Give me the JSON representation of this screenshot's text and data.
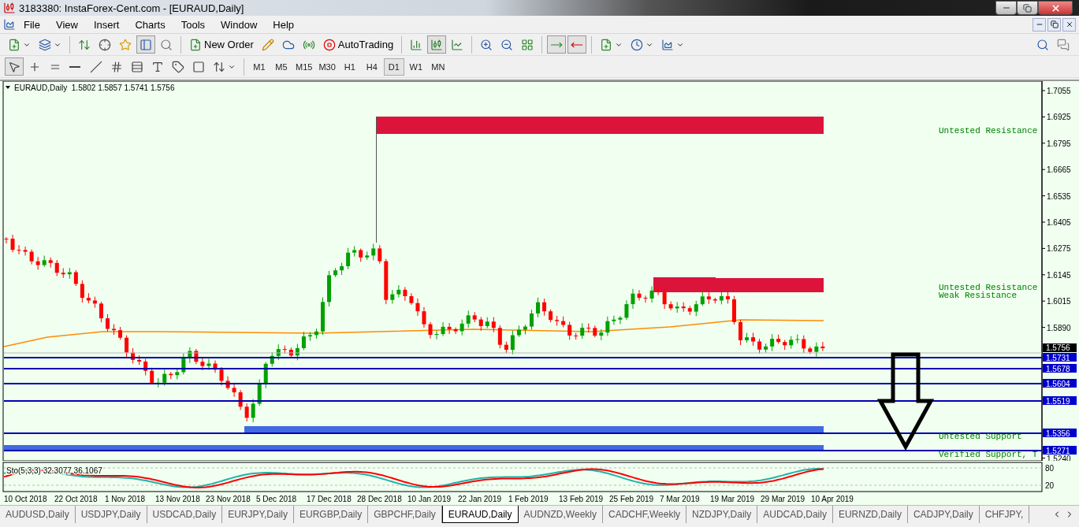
{
  "window": {
    "title": "3183380: InstaForex-Cent.com - [EURAUD,Daily]"
  },
  "menu": [
    "File",
    "View",
    "Insert",
    "Charts",
    "Tools",
    "Window",
    "Help"
  ],
  "toolbar": {
    "new_order": "New Order",
    "auto_trading": "AutoTrading",
    "auto_scroll": true,
    "chart_shift": true,
    "chart_types": [
      {
        "kind": "bars",
        "selected": false
      },
      {
        "kind": "candles",
        "selected": true
      },
      {
        "kind": "line",
        "selected": false
      }
    ]
  },
  "draw_tools": [
    {
      "kind": "cursor",
      "selected": true
    },
    {
      "kind": "crosshair",
      "selected": false
    },
    {
      "kind": "vline",
      "selected": false
    },
    {
      "kind": "hline",
      "selected": false
    },
    {
      "kind": "trend",
      "selected": false
    },
    {
      "kind": "channel",
      "selected": false
    },
    {
      "kind": "fibo",
      "selected": false
    },
    {
      "kind": "text",
      "selected": false
    },
    {
      "kind": "label",
      "selected": false
    },
    {
      "kind": "rectangle",
      "selected": false
    },
    {
      "kind": "arrows",
      "selected": false
    }
  ],
  "timeframes": [
    {
      "label": "M1",
      "selected": false
    },
    {
      "label": "M5",
      "selected": false
    },
    {
      "label": "M15",
      "selected": false
    },
    {
      "label": "M30",
      "selected": false
    },
    {
      "label": "H1",
      "selected": false
    },
    {
      "label": "H4",
      "selected": false
    },
    {
      "label": "D1",
      "selected": true
    },
    {
      "label": "W1",
      "selected": false
    },
    {
      "label": "MN",
      "selected": false
    }
  ],
  "chart": {
    "header": "EURAUD,Daily  1.5802 1.5857 1.5741 1.5756",
    "price_ticks": [
      "1.7055",
      "1.6925",
      "1.6795",
      "1.6665",
      "1.6535",
      "1.6405",
      "1.6275",
      "1.6145",
      "1.6015",
      "1.5890",
      "1.5240"
    ],
    "current_price": "1.5756",
    "levels": [
      {
        "price": "1.5731"
      },
      {
        "price": "1.5678"
      },
      {
        "price": "1.5604"
      },
      {
        "price": "1.5519"
      },
      {
        "price": "1.5356"
      },
      {
        "price": "1.5271"
      }
    ],
    "zone_labels": [
      "Untested Resistance",
      "Untested Resistance",
      "Weak Resistance",
      "Untested Support",
      "Verified Support, T"
    ],
    "indicator": {
      "label": "Sto(5,3,3) 32.3077 36.1067",
      "ticks": [
        "80",
        "20"
      ]
    },
    "dates": [
      "10 Oct 2018",
      "22 Oct 2018",
      "1 Nov 2018",
      "13 Nov 2018",
      "23 Nov 2018",
      "5 Dec 2018",
      "17 Dec 2018",
      "28 Dec 2018",
      "10 Jan 2019",
      "22 Jan 2019",
      "1 Feb 2019",
      "13 Feb 2019",
      "25 Feb 2019",
      "7 Mar 2019",
      "19 Mar 2019",
      "29 Mar 2019",
      "10 Apr 2019"
    ]
  },
  "tabs": [
    {
      "label": "AUDUSD,Daily",
      "selected": false
    },
    {
      "label": "USDJPY,Daily",
      "selected": false
    },
    {
      "label": "USDCAD,Daily",
      "selected": false
    },
    {
      "label": "EURJPY,Daily",
      "selected": false
    },
    {
      "label": "EURGBP,Daily",
      "selected": false
    },
    {
      "label": "GBPCHF,Daily",
      "selected": false
    },
    {
      "label": "EURAUD,Daily",
      "selected": true
    },
    {
      "label": "AUDNZD,Weekly",
      "selected": false
    },
    {
      "label": "CADCHF,Weekly",
      "selected": false
    },
    {
      "label": "NZDJPY,Daily",
      "selected": false
    },
    {
      "label": "AUDCAD,Daily",
      "selected": false
    },
    {
      "label": "EURNZD,Daily",
      "selected": false
    },
    {
      "label": "CADJPY,Daily",
      "selected": false
    },
    {
      "label": "CHFJPY,",
      "selected": false
    }
  ]
}
